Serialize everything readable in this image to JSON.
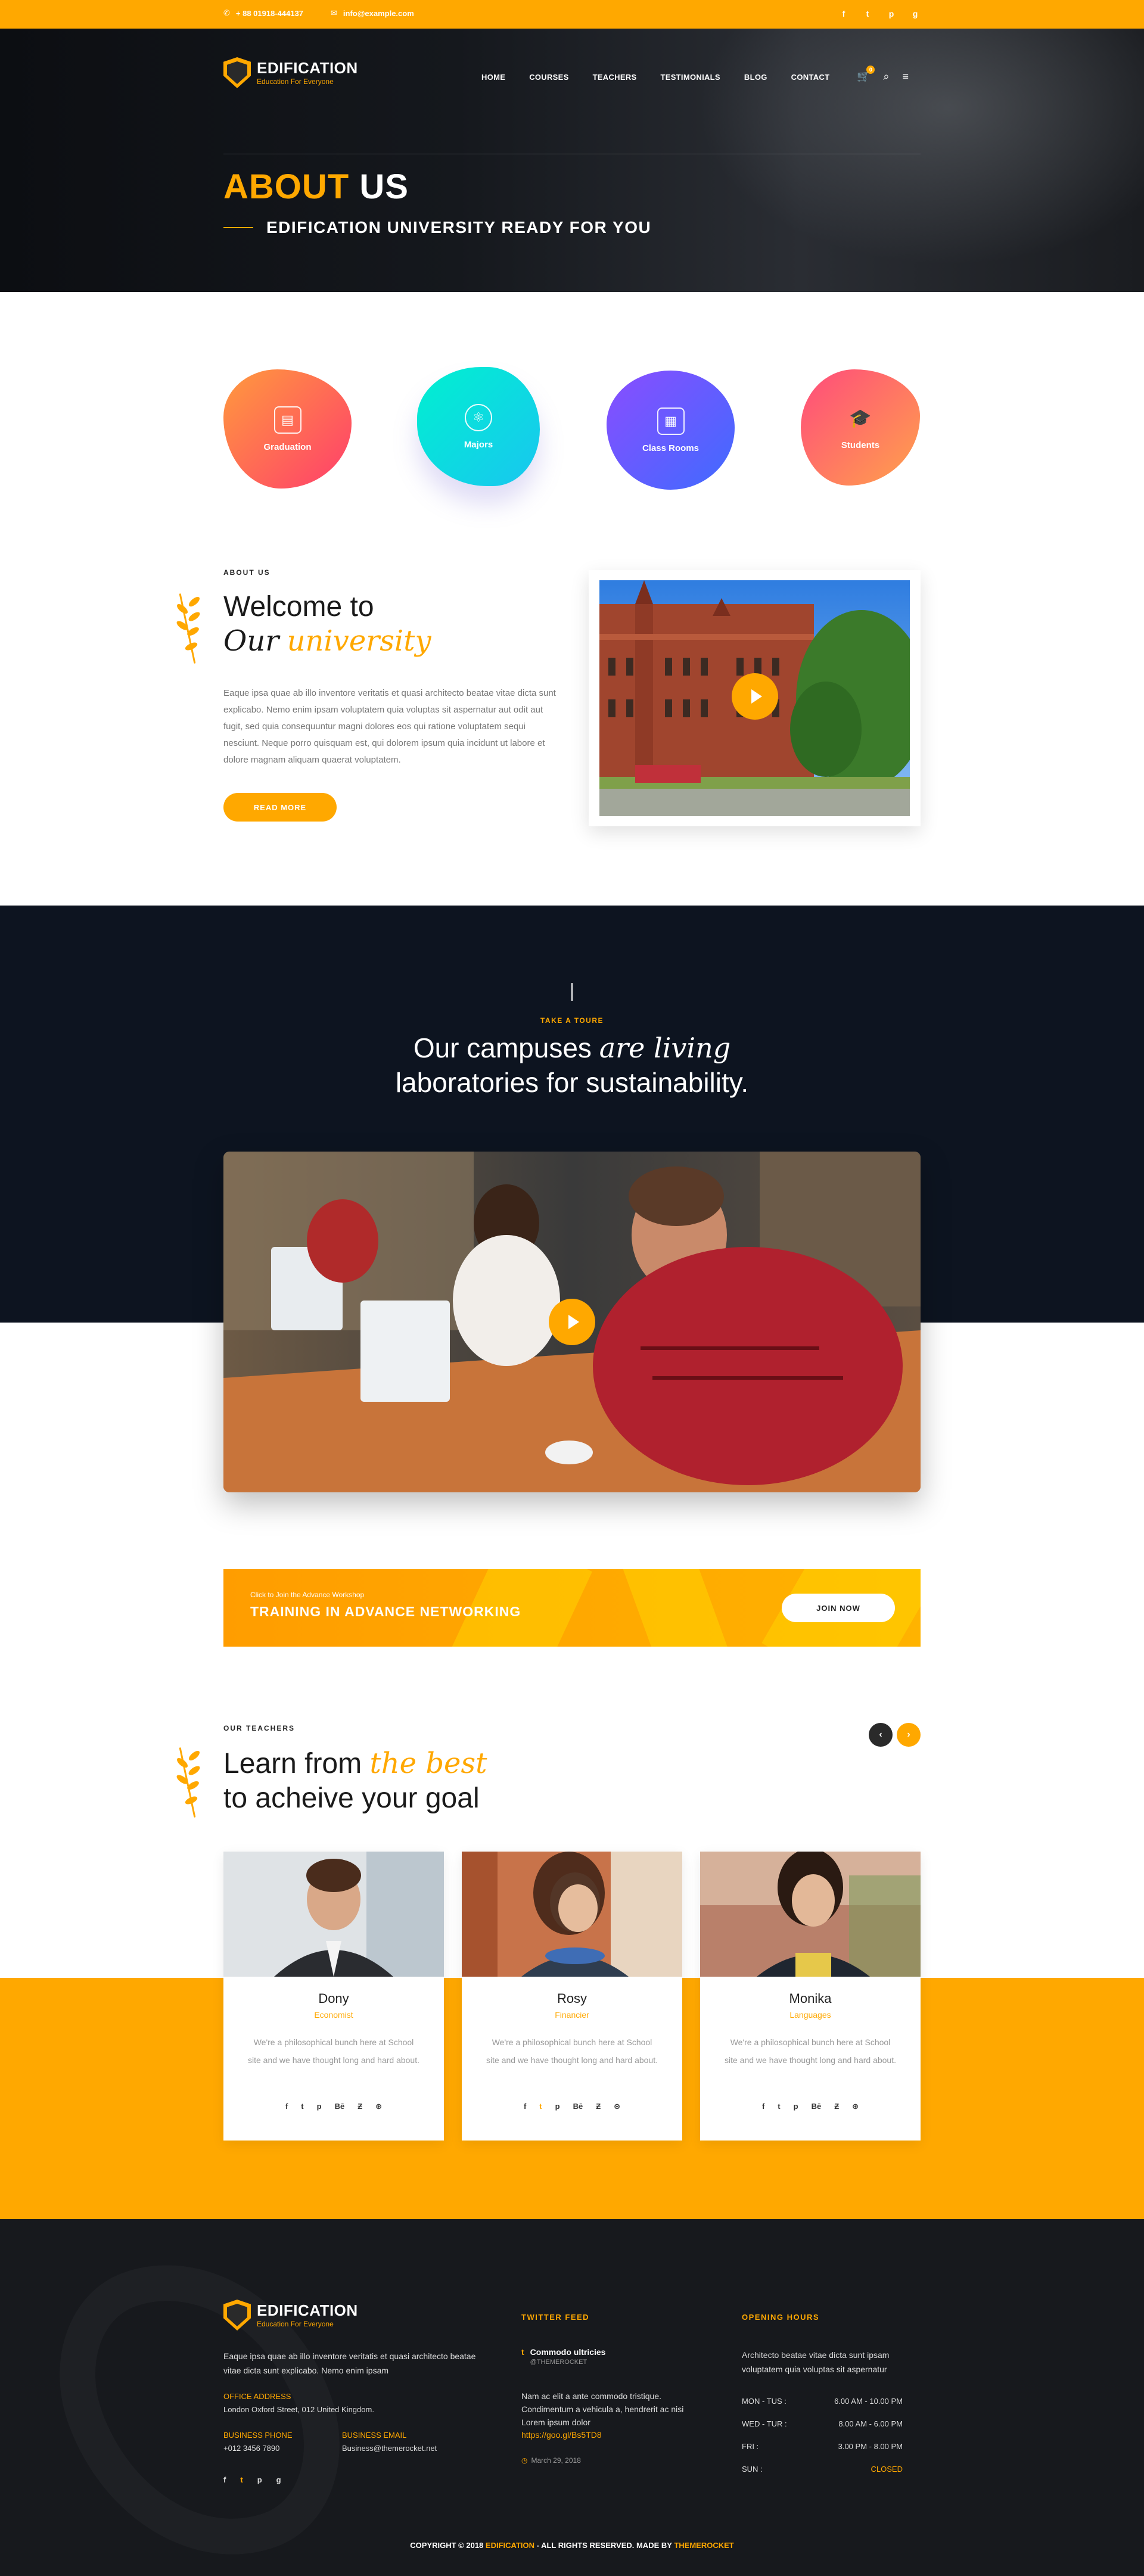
{
  "topbar": {
    "phone": "+ 88 01918-444137",
    "email": "info@example.com",
    "social": [
      "f",
      "t",
      "p",
      "g"
    ]
  },
  "brand": {
    "name": "EDIFICATION",
    "tagline": "Education For Everyone"
  },
  "nav": {
    "items": [
      "HOME",
      "COURSES",
      "TEACHERS",
      "TESTIMONIALS",
      "BLOG",
      "CONTACT"
    ],
    "cart_count": "0"
  },
  "hero": {
    "title_a": "ABOUT",
    "title_b": "US",
    "subtitle": "EDIFICATION UNIVERSITY READY FOR YOU"
  },
  "features": [
    {
      "label": "Graduation",
      "icon": "certificate-icon",
      "color_from": "#ff9a3d",
      "color_to": "#ff3e6c"
    },
    {
      "label": "Majors",
      "icon": "atom-icon",
      "color_from": "#00f0d0",
      "color_to": "#19c6f0"
    },
    {
      "label": "Class Rooms",
      "icon": "building-icon",
      "color_from": "#8a4dff",
      "color_to": "#3f6bff"
    },
    {
      "label": "Students",
      "icon": "graduate-icon",
      "color_from": "#ff4b7c",
      "color_to": "#ffa24b"
    }
  ],
  "about": {
    "label": "ABOUT US",
    "heading_line1": "Welcome to",
    "heading_line2a": "Our",
    "heading_line2b": "university",
    "paragraph": "Eaque ipsa quae ab illo inventore veritatis et quasi architecto beatae vitae dicta sunt explicabo. Nemo enim ipsam voluptatem quia voluptas sit aspernatur aut odit aut fugit, sed quia consequuntur magni dolores eos qui ratione voluptatem sequi nesciunt. Neque porro quisquam est, qui dolorem ipsum quia incidunt ut labore et dolore magnam aliquam quaerat voluptatem.",
    "button": "READ MORE"
  },
  "campus": {
    "label": "TAKE A TOURE",
    "line1a": "Our campuses",
    "line1b": "are living",
    "line2": "laboratories for sustainability."
  },
  "banner": {
    "small": "Click to Join the Advance Workshop",
    "title": "TRAINING IN ADVANCE NETWORKING",
    "button": "JOIN NOW"
  },
  "teachers": {
    "label": "OUR TEACHERS",
    "heading_line1a": "Learn from",
    "heading_line1b": "the best",
    "heading_line2": "to acheive your goal",
    "items": [
      {
        "name": "Dony",
        "role": "Economist",
        "desc": "We're a philosophical bunch here at School site and we have thought long and hard about."
      },
      {
        "name": "Rosy",
        "role": "Financier",
        "desc": "We're a philosophical bunch here at School site and we have thought long and hard about."
      },
      {
        "name": "Monika",
        "role": "Languages",
        "desc": "We're a philosophical bunch here at School site and we have thought long and hard about."
      }
    ],
    "social": [
      "f",
      "t",
      "p",
      "Bē",
      "Ƶ",
      "⊛"
    ]
  },
  "footer": {
    "about_text": "Eaque ipsa quae ab illo inventore veritatis et quasi architecto beatae vitae dicta sunt explicabo. Nemo enim ipsam",
    "office_label": "OFFICE ADDRESS",
    "office_value": "London Oxford Street, 012 United Kingdom.",
    "phone_label": "BUSINESS PHONE",
    "phone_value": "+012 3456 7890",
    "email_label": "BUSINESS EMAIL",
    "email_value": "Business@themerocket.net",
    "twitter_title": "TWITTER FEED",
    "tweet_author": "Commodo ultricies",
    "tweet_handle": "@THEMEROCKET",
    "tweet_text": "Nam ac elit a ante commodo tristique. Condimentum a vehicula a, hendrerit ac nisi Lorem ipsum dolor",
    "tweet_link": "https://goo.gl/Bs5TD8",
    "tweet_date": "March 29, 2018",
    "hours_title": "OPENING HOURS",
    "hours_text": "Architecto beatae vitae dicta sunt ipsam voluptatem quia voluptas sit aspernatur",
    "hours": [
      {
        "day": "MON - TUS :",
        "time": "6.00 AM - 10.00 PM"
      },
      {
        "day": "WED - TUR :",
        "time": "8.00 AM - 6.00 PM"
      },
      {
        "day": "FRI :",
        "time": "3.00 PM - 8.00 PM"
      },
      {
        "day": "SUN :",
        "time": "CLOSED"
      }
    ],
    "copyright_a": "COPYRIGHT © 2018",
    "copyright_brand": "EDIFICATION",
    "copyright_b": "- ALL RIGHTS RESERVED. MADE BY",
    "copyright_maker": "THEMEROCKET"
  }
}
